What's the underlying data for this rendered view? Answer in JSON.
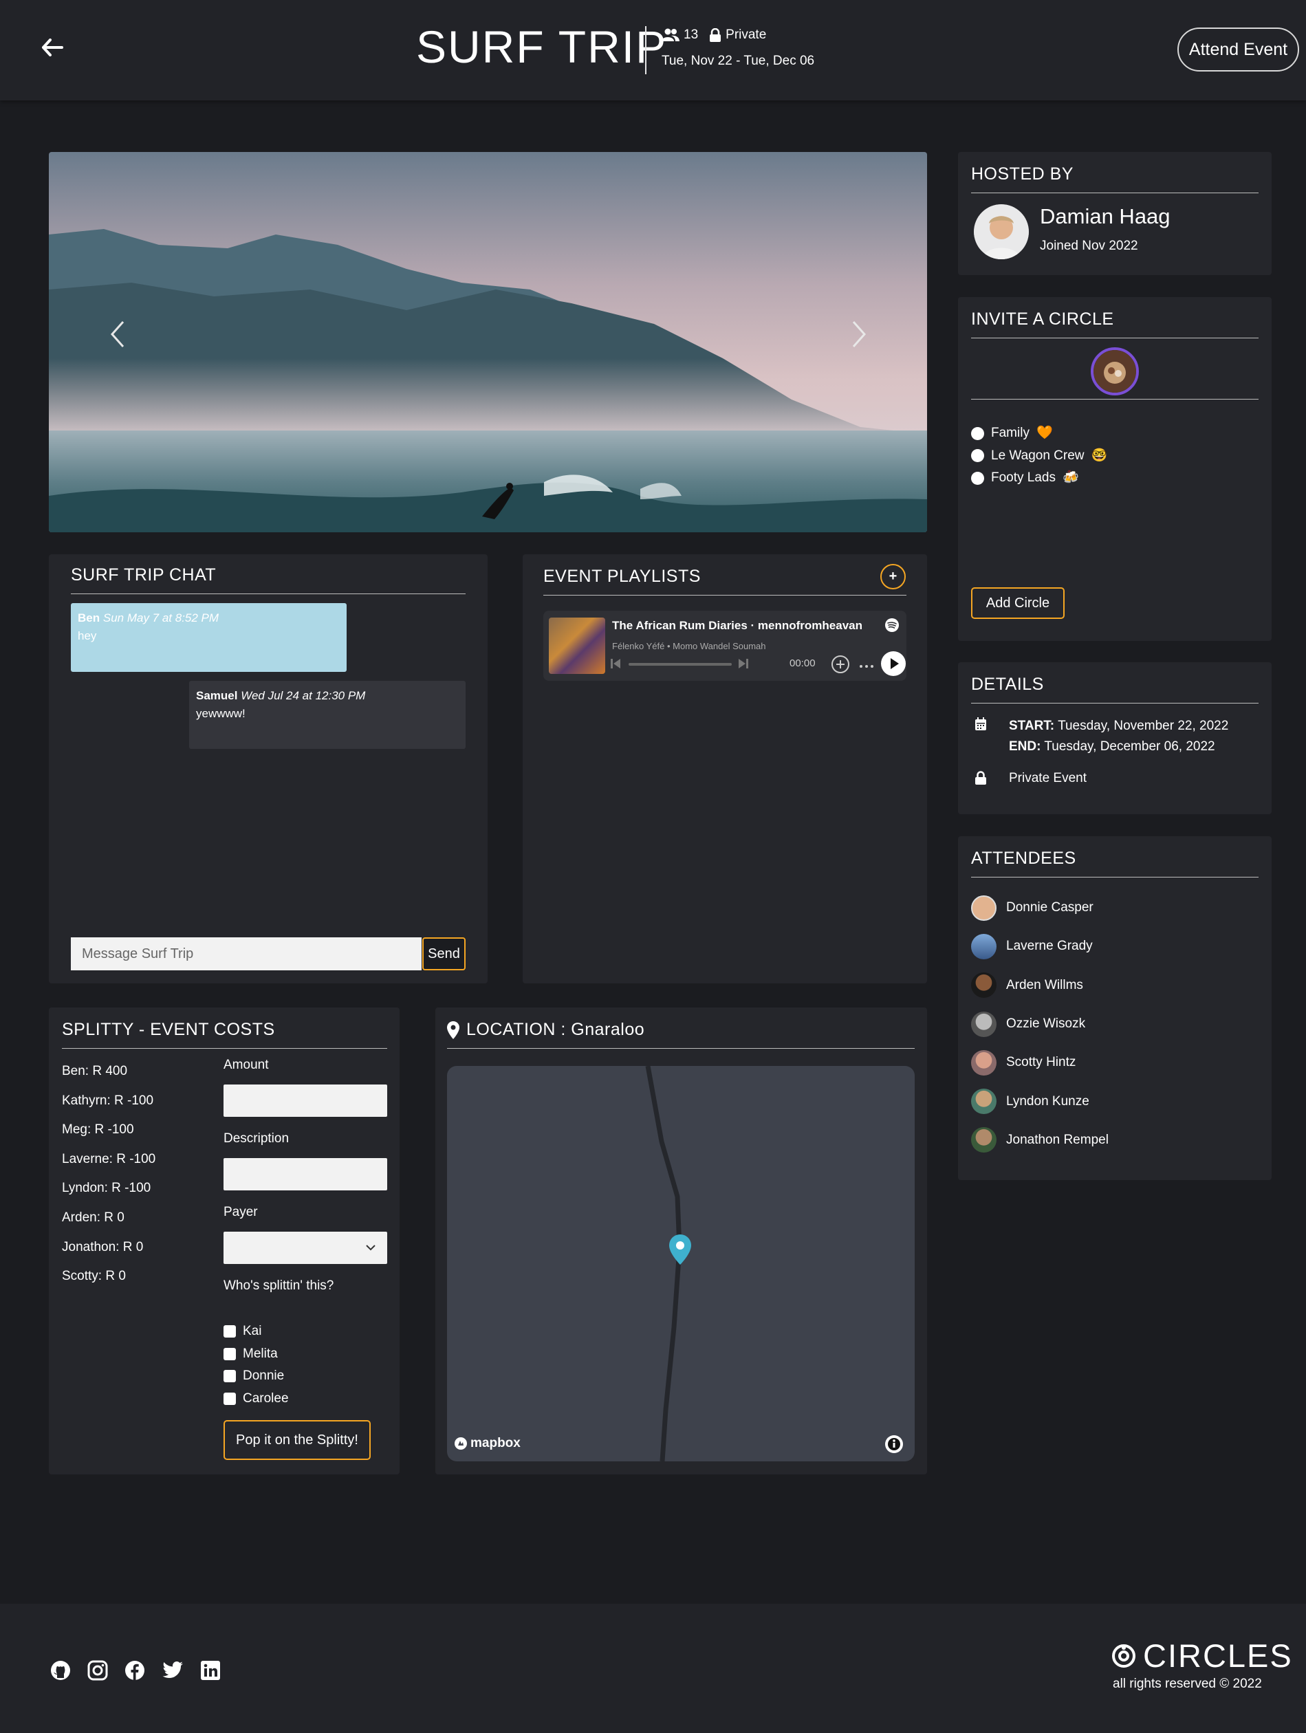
{
  "header": {
    "title": "SURF TRIP",
    "attendee_count": "13",
    "privacy": "Private",
    "dates": "Tue, Nov 22 - Tue, Dec 06",
    "attend_label": "Attend Event"
  },
  "chat": {
    "title": "SURF TRIP CHAT",
    "messages": [
      {
        "author": "Ben",
        "time": "Sun May 7 at 8:52 PM",
        "text": "hey"
      },
      {
        "author": "Samuel",
        "time": "Wed Jul 24 at 12:30 PM",
        "text": "yewwww!"
      }
    ],
    "placeholder": "Message Surf Trip",
    "send_label": "Send"
  },
  "playlists": {
    "title": "EVENT PLAYLISTS",
    "add_label": "+",
    "track": {
      "title": "The African Rum Diaries · mennofromheavan",
      "artists": "Félenko Yéfé • Momo Wandel Soumah",
      "time": "00:00"
    }
  },
  "host": {
    "heading": "HOSTED BY",
    "name": "Damian Haag",
    "joined": "Joined Nov 2022"
  },
  "invite": {
    "heading": "INVITE A CIRCLE",
    "circles": [
      {
        "label": "Family",
        "emoji": "🧡"
      },
      {
        "label": "Le Wagon Crew",
        "emoji": "🤓"
      },
      {
        "label": "Footy Lads",
        "emoji": "🍻"
      }
    ],
    "add_label": "Add Circle"
  },
  "details": {
    "heading": "DETAILS",
    "start_label": "START:",
    "start_value": "Tuesday, November 22, 2022",
    "end_label": "END:",
    "end_value": "Tuesday, December 06, 2022",
    "privacy": "Private Event"
  },
  "attendees": {
    "heading": "ATTENDEES",
    "people": [
      "Donnie Casper",
      "Laverne Grady",
      "Arden Willms",
      "Ozzie Wisozk",
      "Scotty Hintz",
      "Lyndon Kunze",
      "Jonathon Rempel"
    ]
  },
  "splitty": {
    "heading": "SPLITTY - EVENT COSTS",
    "balances": [
      "Ben: R 400",
      "Kathyrn: R -100",
      "Meg: R -100",
      "Laverne: R -100",
      "Lyndon: R -100",
      "Arden: R 0",
      "Jonathon: R 0",
      "Scotty: R 0"
    ],
    "amount_label": "Amount",
    "description_label": "Description",
    "payer_label": "Payer",
    "splitters_label": "Who's splittin' this?",
    "splitters": [
      "Kai",
      "Melita",
      "Donnie",
      "Carolee"
    ],
    "submit_label": "Pop it on the Splitty!"
  },
  "location": {
    "heading_prefix": "LOCATION : ",
    "place": "Gnaraloo",
    "map_brand": "mapbox"
  },
  "footer": {
    "brand": "CIRCLES",
    "copyright": "all rights reserved © 2022"
  },
  "colors": {
    "accent": "#f5a623",
    "chat_own": "#add8e6",
    "chat_other": "#34353b",
    "map_pin": "#3fb1ce"
  }
}
